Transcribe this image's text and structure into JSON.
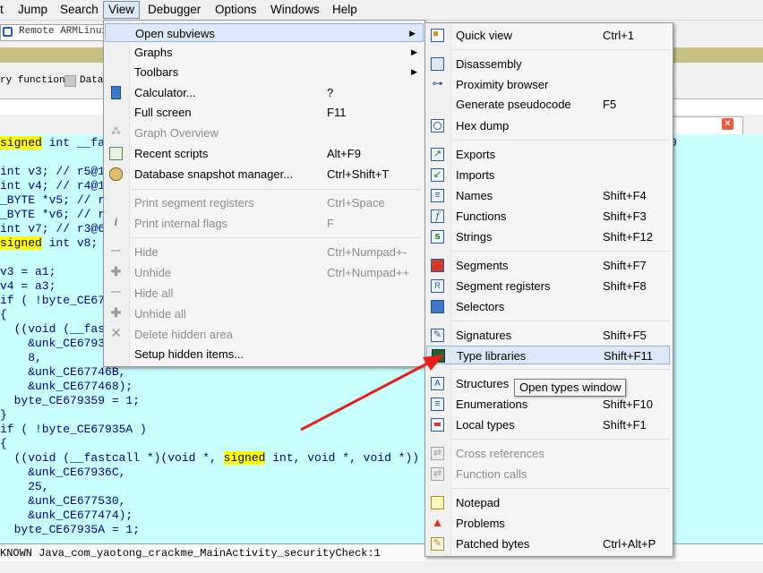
{
  "menubar": {
    "items": [
      "t",
      "Jump",
      "Search",
      "View",
      "Debugger",
      "Options",
      "Windows",
      "Help"
    ]
  },
  "toolbar": {
    "remote_debugger": "Remote ARMLinux/"
  },
  "legend": {
    "item1": "ry function",
    "item2": "Data"
  },
  "code": {
    "lines": [
      {
        "a": "signed",
        "b": " int __fast"
      },
      {
        "a": "int v3; // r5@1"
      },
      {
        "a": "int v4; // r4@1"
      },
      {
        "a": "_BYTE *v5; // r"
      },
      {
        "a": "_BYTE *v6; // r"
      },
      {
        "a": "int v7; // r3@6"
      },
      {
        "a": "signed",
        "b": " int v8;"
      },
      {
        "a": "v3 = a1;"
      },
      {
        "a": "v4 = a3;"
      },
      {
        "a": "if ( !byte_CE67"
      },
      {
        "a": "{"
      },
      {
        "a": "  ((void (__fas"
      },
      {
        "a": "    &unk_CE6793"
      },
      {
        "a": "    8,"
      },
      {
        "a": "    &unk_CE67746B,"
      },
      {
        "a": "    &unk_CE677468);"
      },
      {
        "a": "  byte_CE679359 = 1;"
      },
      {
        "a": "}"
      },
      {
        "a": "if ( !byte_CE67935A )"
      },
      {
        "a": "{"
      },
      {
        "a": "  ((void (__fastcall *)(void *, ",
        "b": "signed",
        "c": " int, void *, void *))"
      },
      {
        "a": "    &unk_CE67936C,"
      },
      {
        "a": "    25,"
      },
      {
        "a": "    &unk_CE677530,"
      },
      {
        "a": "    &unk_CE677474);"
      },
      {
        "a": "  byte_CE67935A = 1;"
      }
    ],
    "right_fragment": "0"
  },
  "status": {
    "text": "KNOWN Java_com_yaotong_crackme_MainActivity_securityCheck:1"
  },
  "view_menu": {
    "items": [
      {
        "label": "Open subviews",
        "shortcut": "",
        "submenu": true,
        "icon": "none",
        "disabled": false
      },
      {
        "label": "Graphs",
        "shortcut": "",
        "submenu": true,
        "icon": "none",
        "disabled": false
      },
      {
        "label": "Toolbars",
        "shortcut": "",
        "submenu": true,
        "icon": "none",
        "disabled": false
      },
      {
        "label": "Calculator...",
        "shortcut": "?",
        "icon": "calculator-icon",
        "disabled": false
      },
      {
        "label": "Full screen",
        "shortcut": "F11",
        "icon": "none",
        "disabled": false
      },
      {
        "label": "Graph Overview",
        "shortcut": "",
        "icon": "graph-overview-icon",
        "disabled": true
      },
      {
        "label": "Recent scripts",
        "shortcut": "Alt+F9",
        "icon": "scripts-icon",
        "disabled": false
      },
      {
        "label": "Database snapshot manager...",
        "shortcut": "Ctrl+Shift+T",
        "icon": "snapshot-icon",
        "disabled": false
      },
      {
        "label": "Print segment registers",
        "shortcut": "Ctrl+Space",
        "icon": "none",
        "disabled": true
      },
      {
        "label": "Print internal flags",
        "shortcut": "F",
        "icon": "info-icon",
        "disabled": true
      },
      {
        "label": "Hide",
        "shortcut": "Ctrl+Numpad+-",
        "icon": "minus-icon",
        "disabled": true
      },
      {
        "label": "Unhide",
        "shortcut": "Ctrl+Numpad++",
        "icon": "plus-icon",
        "disabled": true
      },
      {
        "label": "Hide all",
        "shortcut": "",
        "icon": "minus-icon",
        "disabled": true
      },
      {
        "label": "Unhide all",
        "shortcut": "",
        "icon": "plus-icon",
        "disabled": true
      },
      {
        "label": "Delete hidden area",
        "shortcut": "",
        "icon": "delete-icon",
        "disabled": true
      },
      {
        "label": "Setup hidden items...",
        "shortcut": "",
        "icon": "none",
        "disabled": false
      }
    ]
  },
  "subviews_menu": {
    "items": [
      {
        "label": "Quick view",
        "shortcut": "Ctrl+1",
        "icon": "quick-view-icon"
      },
      {
        "label": "Disassembly",
        "shortcut": "",
        "icon": "disassembly-icon"
      },
      {
        "label": "Proximity browser",
        "shortcut": "",
        "icon": "proximity-icon"
      },
      {
        "label": "Generate pseudocode",
        "shortcut": "F5",
        "icon": "none"
      },
      {
        "label": "Hex dump",
        "shortcut": "",
        "icon": "hex-icon"
      },
      {
        "label": "Exports",
        "shortcut": "",
        "icon": "exports-icon"
      },
      {
        "label": "Imports",
        "shortcut": "",
        "icon": "imports-icon"
      },
      {
        "label": "Names",
        "shortcut": "Shift+F4",
        "icon": "names-icon"
      },
      {
        "label": "Functions",
        "shortcut": "Shift+F3",
        "icon": "functions-icon"
      },
      {
        "label": "Strings",
        "shortcut": "Shift+F12",
        "icon": "strings-icon"
      },
      {
        "label": "Segments",
        "shortcut": "Shift+F7",
        "icon": "segments-icon"
      },
      {
        "label": "Segment registers",
        "shortcut": "Shift+F8",
        "icon": "segment-registers-icon"
      },
      {
        "label": "Selectors",
        "shortcut": "",
        "icon": "selectors-icon"
      },
      {
        "label": "Signatures",
        "shortcut": "Shift+F5",
        "icon": "signatures-icon"
      },
      {
        "label": "Type libraries",
        "shortcut": "Shift+F11",
        "icon": "type-libraries-icon"
      },
      {
        "label": "Structures",
        "shortcut": "F9",
        "icon": "structures-icon"
      },
      {
        "label": "Enumerations",
        "shortcut": "Shift+F10",
        "icon": "enumerations-icon"
      },
      {
        "label": "Local types",
        "shortcut": "Shift+F1",
        "icon": "local-types-icon"
      },
      {
        "label": "Cross references",
        "shortcut": "",
        "icon": "xrefs-icon",
        "disabled": true
      },
      {
        "label": "Function calls",
        "shortcut": "",
        "icon": "function-calls-icon",
        "disabled": true
      },
      {
        "label": "Notepad",
        "shortcut": "",
        "icon": "notepad-icon"
      },
      {
        "label": "Problems",
        "shortcut": "",
        "icon": "problems-icon"
      },
      {
        "label": "Patched bytes",
        "shortcut": "Ctrl+Alt+P",
        "icon": "patched-bytes-icon"
      }
    ]
  },
  "tooltip": {
    "text": "Open types window"
  },
  "colors": {
    "code_bg": "#c8ffff",
    "highlight": "#ffff00",
    "menu_hover": "#dce8f7",
    "annotation_arrow": "#e8201c"
  }
}
